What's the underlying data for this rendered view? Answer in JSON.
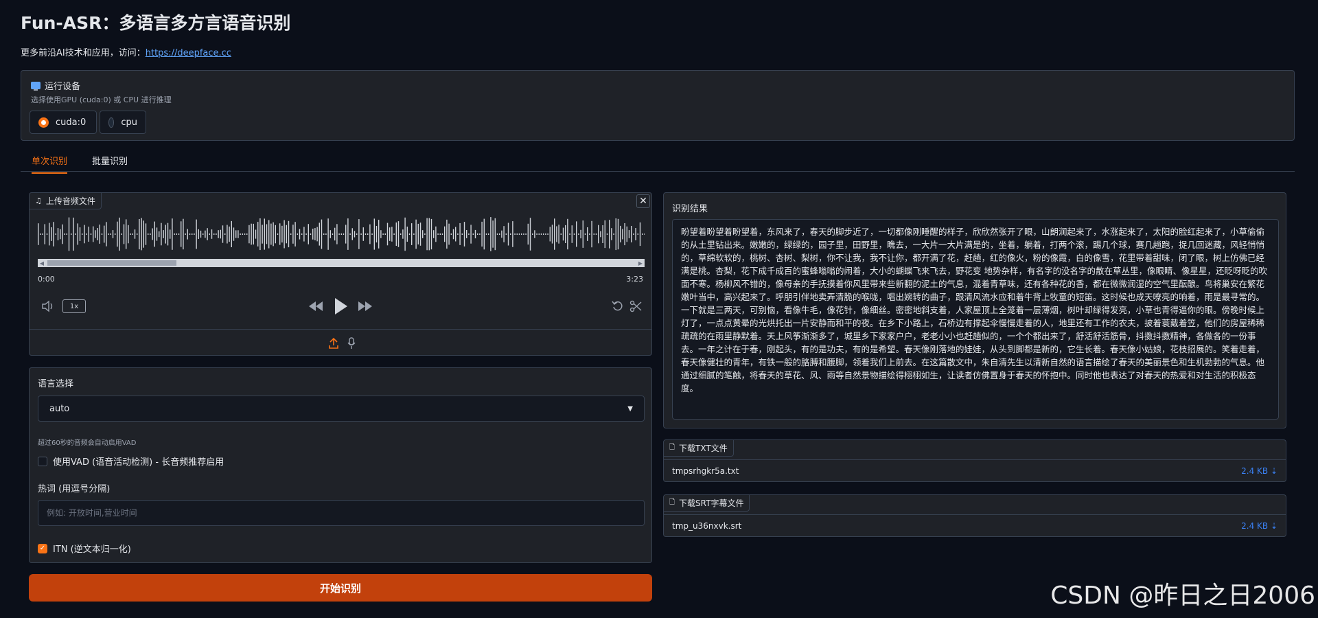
{
  "header": {
    "title": "Fun-ASR：多语言多方言语音识别",
    "subtitle_prefix": "更多前沿AI技术和应用，访问：",
    "subtitle_link": "https://deepface.cc"
  },
  "device": {
    "title": "运行设备",
    "info": "选择使用GPU (cuda:0) 或 CPU 进行推理",
    "options": [
      "cuda:0",
      "cpu"
    ],
    "selected": "cuda:0"
  },
  "tabs": [
    "单次识别",
    "批量识别"
  ],
  "audio": {
    "label": "上传音频文件",
    "time_start": "0:00",
    "time_end": "3:23",
    "speed": "1x"
  },
  "options": {
    "language_label": "语言选择",
    "language_value": "auto",
    "vad_info": "超过60秒的音频会自动启用VAD",
    "vad_label": "使用VAD (语音活动检测) - 长音频推荐启用",
    "vad_checked": false,
    "hotwords_label": "热词 (用逗号分隔)",
    "hotwords_placeholder": "例如: 开放时间,营业时间",
    "itn_label": "ITN (逆文本归一化)",
    "itn_checked": true
  },
  "submit_label": "开始识别",
  "result": {
    "label": "识别结果",
    "text": "盼望着盼望着盼望着，东风来了，春天的脚步近了，一切都像刚睡醒的样子，欣欣然张开了眼，山朗润起来了，水涨起来了，太阳的脸红起来了，小草偷偷的从土里钻出来。嫩嫩的，绿绿的，园子里，田野里，瞧去，一大片一大片满是的，坐着，躺着，打两个滚，踢几个球，赛几趟跑，捉几回迷藏，风轻悄悄的，草绵软软的，桃树、杏树、梨树，你不让我，我不让你，都开满了花，赶趟，红的像火，粉的像霞，白的像雪，花里带着甜味，闭了眼，树上仿佛已经满是桃。杏梨，花下成千成百的蜜蜂嗡嗡的闹着，大小的蝴蝶飞来飞去，野花变 地势杂样，有名字的没名字的散在草丛里，像眼睛、像星星，还眨呀眨的吹面不寒。杨柳风不错的，像母亲的手抚摸着你风里带来些新翻的泥土的气息，混着青草味，还有各种花的香，都在微微润湿的空气里酝酿。鸟将巢安在繁花嫩叶当中，高兴起来了。呼朋引伴地卖弄清脆的喉咙，唱出婉转的曲子，跟清风流水应和着牛背上牧童的短笛。这时候也成天嘹亮的响着，雨是最寻常的。一下就是三两天，可别恼，看像牛毛，像花针，像细丝。密密地斜支着，人家屋顶上全笼着一层薄烟，树叶却绿得发亮，小草也青得逼你的眼。傍晚时候上灯了，一点点黄晕的光烘托出一片安静而和平的夜。在乡下小路上，石桥边有撑起伞慢慢走着的人，地里还有工作的农夫，披着蓑戴着笠，他们的房屋稀稀疏疏的在雨里静默着。天上风筝渐渐多了，城里乡下家家户户，老老小小也赶趟似的，一个个都出来了，舒活舒活筋骨，抖擞抖擞精神，各做各的一份事去。一年之计在于春，刚起头，有的是功夫，有的是希望。春天像刚落地的娃娃，从头到脚都是新的，它生长着。春天像小姑娘，花枝招展的。笑着走着，春天像健壮的青年，有铁一般的胳膊和腰脚，领着我们上前去。在这篇散文中，朱自清先生以清新自然的语言描绘了春天的美丽景色和生机勃勃的气息。他通过细腻的笔触，将春天的草花、风、雨等自然景物描绘得栩栩如生，让读者仿佛置身于春天的怀抱中。同时他也表达了对春天的热爱和对生活的积极态度。"
  },
  "downloads": [
    {
      "label": "下载TXT文件",
      "filename": "tmpsrhgkr5a.txt",
      "size": "2.4 KB ⇣"
    },
    {
      "label": "下载SRT字幕文件",
      "filename": "tmp_u36nxvk.srt",
      "size": "2.4 KB ⇣"
    }
  ],
  "watermark": "CSDN @昨日之日2006",
  "colors": {
    "accent": "#f97316",
    "button": "#c2410c",
    "link": "#60a5fa",
    "background": "#0b0f19",
    "panel": "#1f2228"
  }
}
